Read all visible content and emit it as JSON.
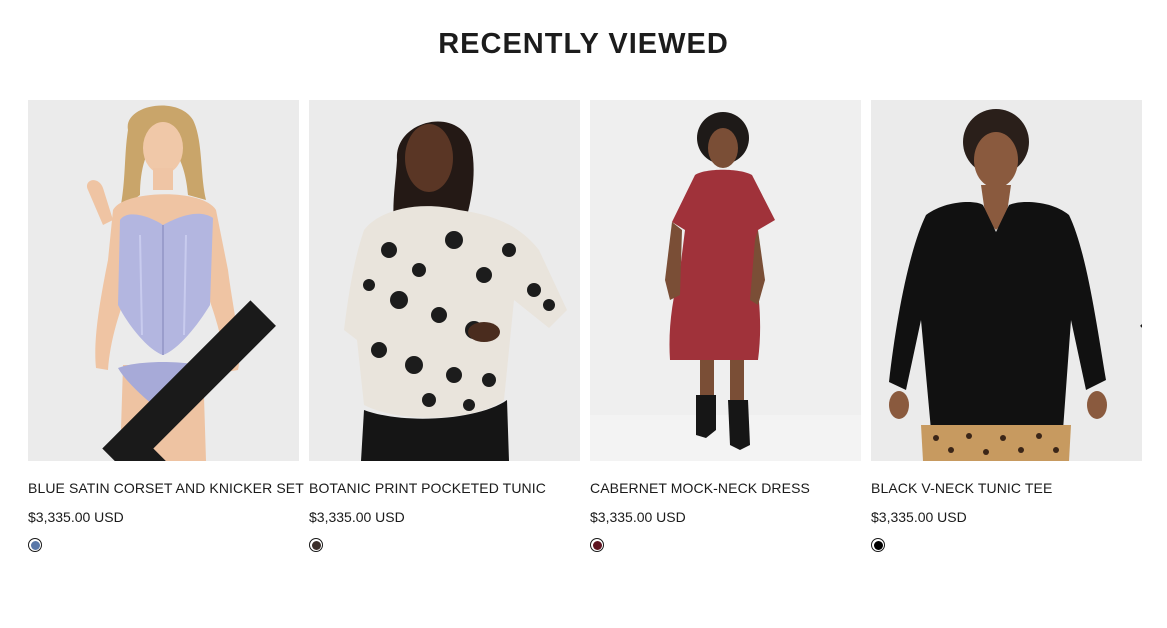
{
  "section": {
    "title": "RECENTLY VIEWED"
  },
  "carousel": {
    "prev_icon": "chevron-left-icon",
    "next_icon": "chevron-right-icon"
  },
  "products": [
    {
      "title": "BLUE SATIN CORSET AND KNICKER SET",
      "price": "$3,335.00 USD",
      "swatch_color": "#5a78a8",
      "image_bg": "#ececec"
    },
    {
      "title": "BOTANIC PRINT POCKETED TUNIC",
      "price": "$3,335.00 USD",
      "swatch_color": "#3a2e2a",
      "image_bg": "#ececec"
    },
    {
      "title": "CABERNET MOCK-NECK DRESS",
      "price": "$3,335.00 USD",
      "swatch_color": "#5e1420",
      "image_bg": "#eeeeee"
    },
    {
      "title": "BLACK V-NECK TUNIC TEE",
      "price": "$3,335.00 USD",
      "swatch_color": "#000000",
      "image_bg": "#ececec"
    }
  ]
}
